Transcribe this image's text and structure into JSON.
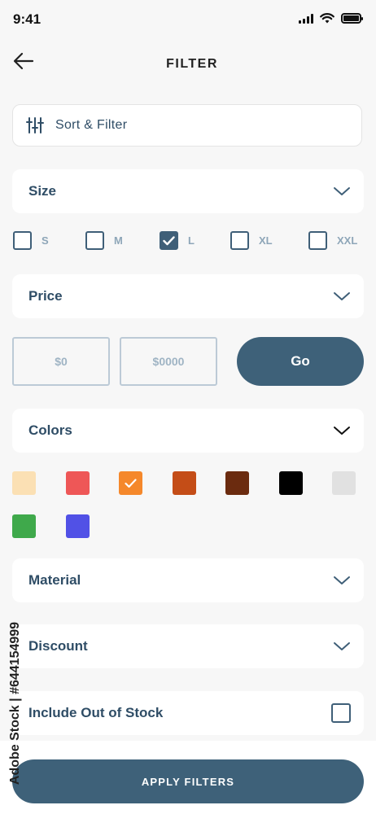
{
  "status_bar": {
    "time": "9:41"
  },
  "header": {
    "title": "FILTER"
  },
  "sort_filter": {
    "label": "Sort & Filter"
  },
  "sections": {
    "size": "Size",
    "price": "Price",
    "colors": "Colors",
    "material": "Material",
    "discount": "Discount",
    "out_of_stock": "Include Out of Stock"
  },
  "sizes": [
    {
      "label": "S",
      "checked": false
    },
    {
      "label": "M",
      "checked": false
    },
    {
      "label": "L",
      "checked": true
    },
    {
      "label": "XL",
      "checked": false
    },
    {
      "label": "XXL",
      "checked": false
    }
  ],
  "price": {
    "min_placeholder": "$0",
    "max_placeholder": "$0000",
    "go_label": "Go"
  },
  "colors": [
    {
      "hex": "#fbe0b4",
      "selected": false
    },
    {
      "hex": "#ee5757",
      "selected": false
    },
    {
      "hex": "#f5882b",
      "selected": true
    },
    {
      "hex": "#c44d17",
      "selected": false
    },
    {
      "hex": "#6b2b0f",
      "selected": false
    },
    {
      "hex": "#000000",
      "selected": false
    },
    {
      "hex": "#e1e1e1",
      "selected": false
    },
    {
      "hex": "#3fa94b",
      "selected": false
    },
    {
      "hex": "#5151e6",
      "selected": false
    }
  ],
  "apply_label": "APPLY FILTERS",
  "watermark": {
    "text": "Adobe Stock | #644154999"
  }
}
